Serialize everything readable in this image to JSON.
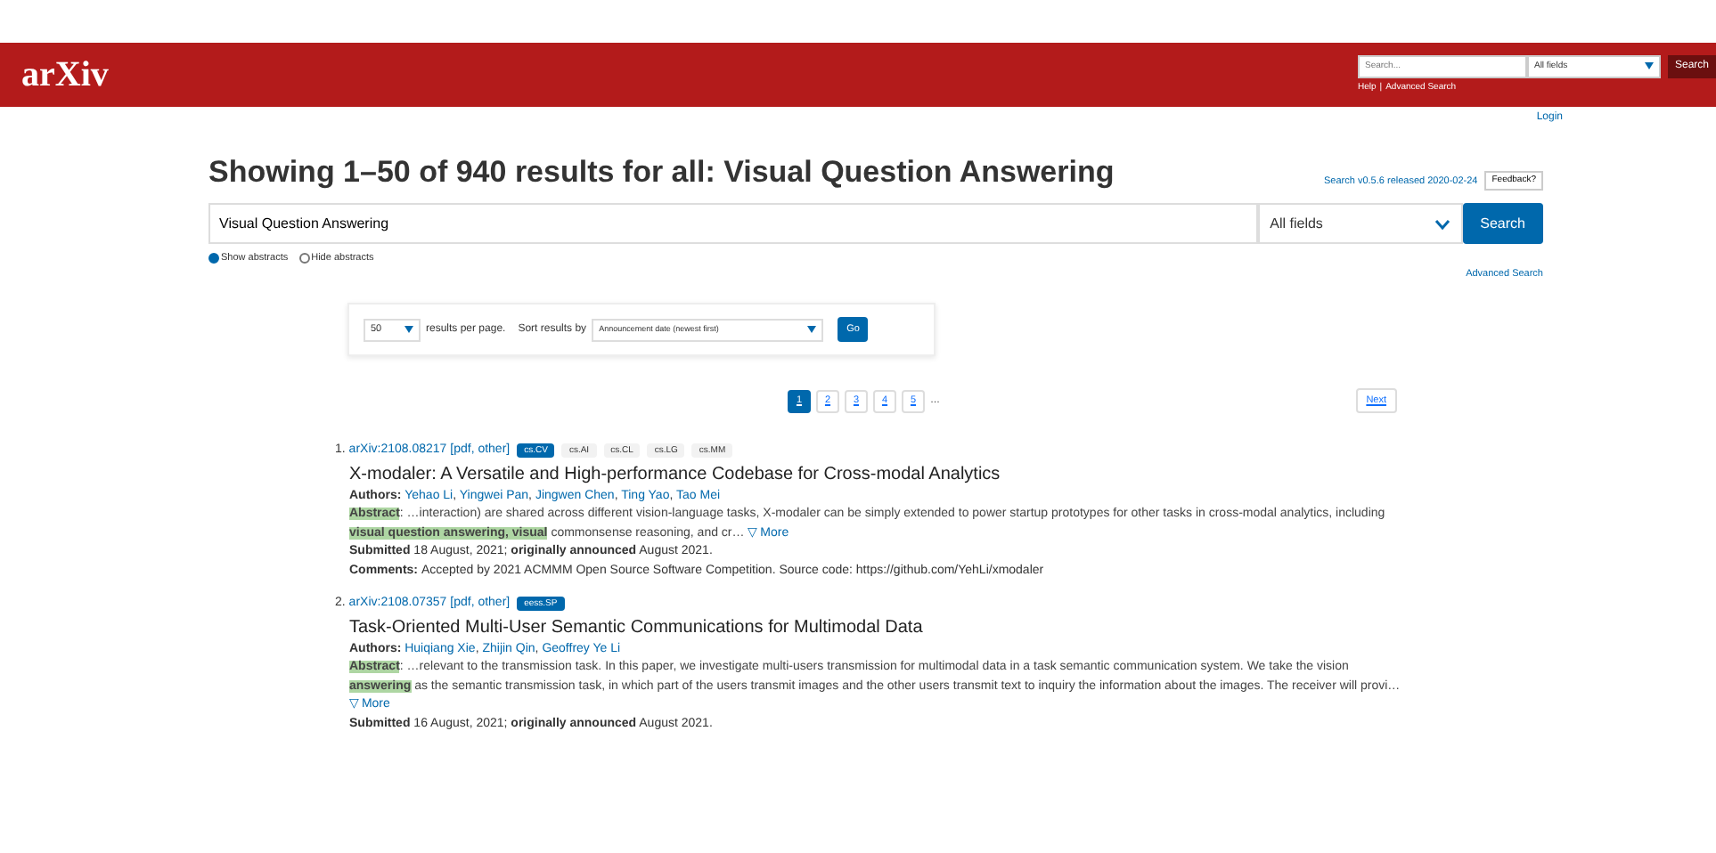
{
  "header": {
    "logo": "arXiv",
    "search": {
      "placeholder": "Search..."
    },
    "field_select": "All fields",
    "search_button": "Search",
    "links": [
      "Help",
      "|",
      "Advanced Search"
    ]
  },
  "login": "Login",
  "heading": "Showing 1–50 of 940 results for all: Visual Question Answering",
  "release_note": "Search v0.5.6 released 2020-02-24",
  "feedback_button": "Feedback?",
  "query": {
    "value": "Visual Question Answering",
    "field": "All fields",
    "button": "Search"
  },
  "abstract_toggle": [
    {
      "label": "Show abstracts",
      "selected": true
    },
    {
      "label": "Hide abstracts",
      "selected": false
    }
  ],
  "advanced_search": "Advanced Search",
  "options": {
    "per_page": "50",
    "per_page_label": "results per page.",
    "sort_label": "Sort results by",
    "sort": "Announcement date (newest first)",
    "go": "Go"
  },
  "pagination": {
    "pages": [
      {
        "label": "1",
        "selected": true
      },
      {
        "label": "2",
        "selected": false
      },
      {
        "label": "3",
        "selected": false
      },
      {
        "label": "4",
        "selected": false
      },
      {
        "label": "5",
        "selected": false
      }
    ],
    "ellipsis": "…",
    "next": "Next"
  },
  "results": [
    {
      "number": "1.",
      "id": "arXiv:2108.08217",
      "formats": "[pdf, other]",
      "tags": [
        {
          "label": "cs.CV",
          "primary": true
        },
        {
          "label": "cs.AI",
          "primary": false
        },
        {
          "label": "cs.CL",
          "primary": false
        },
        {
          "label": "cs.LG",
          "primary": false
        },
        {
          "label": "cs.MM",
          "primary": false
        }
      ],
      "title": "X-modaler: A Versatile and High-performance Codebase for Cross-modal Analytics",
      "authors_label": "Authors:",
      "authors": [
        "Yehao Li",
        "Yingwei Pan",
        "Jingwen Chen",
        "Ting Yao",
        "Tao Mei"
      ],
      "author_separator": ",",
      "abstract": "**Abstract**: …interaction) are shared across different vision-language tasks, X-modaler can be simply extended to power startup prototypes for other tasks in cross-modal analytics, including **visual question answering, visual** commonsense reasoning, and cr…",
      "more": "▽ More",
      "submitted_label": "Submitted",
      "submitted": "18 August, 2021;",
      "announced_label": "originally announced",
      "announced": "August 2021.",
      "comments_label": "Comments:",
      "comments": "Accepted by 2021 ACMMM Open Source Software Competition. Source code: https://github.com/YehLi/xmodaler"
    },
    {
      "number": "2.",
      "id": "arXiv:2108.07357",
      "formats": "[pdf, other]",
      "tags": [
        {
          "label": "eess.SP",
          "primary": true
        }
      ],
      "title": "Task-Oriented Multi-User Semantic Communications for Multimodal Data",
      "authors_label": "Authors:",
      "authors": [
        "Huiqiang Xie",
        "Zhijin Qin",
        "Geoffrey Ye Li"
      ],
      "author_separator": ",",
      "abstract": "**Abstract**: …relevant to the transmission task. In this paper, we investigate multi-users transmission for multimodal data in a task semantic communication system. We take the vision **answering** as the semantic transmission task, in which part of the users transmit images and the other users transmit text to inquiry the information about the images. The receiver will provi…",
      "more": "▽ More",
      "submitted_label": "Submitted",
      "submitted": "16 August, 2021;",
      "announced_label": "originally announced",
      "announced": "August 2021."
    }
  ]
}
